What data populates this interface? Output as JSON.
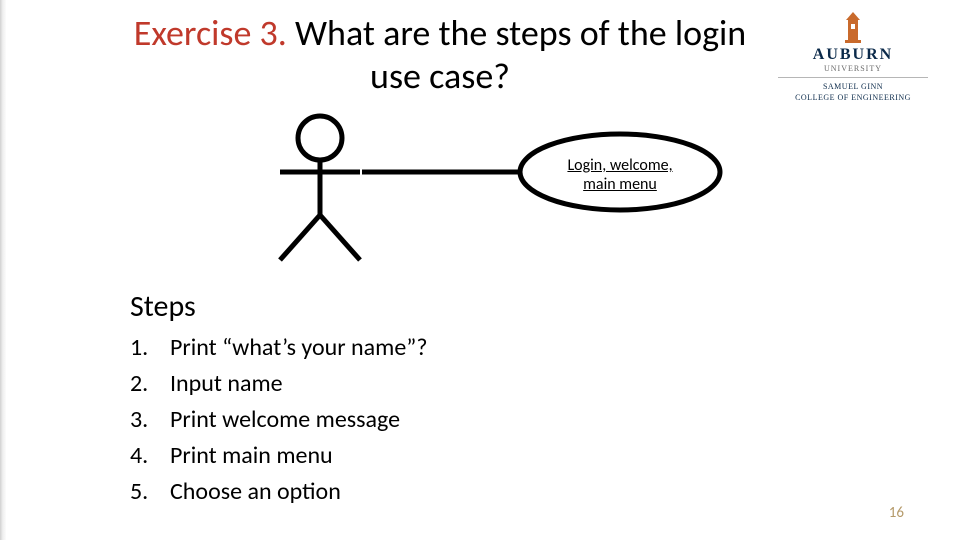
{
  "title": {
    "accent": "Exercise 3.",
    "rest": " What are the steps of the login use case?"
  },
  "logo": {
    "wordmark": "AUBURN",
    "sub1": "UNIVERSITY",
    "sub2": "SAMUEL GINN",
    "sub3": "COLLEGE OF ENGINEERING"
  },
  "diagram": {
    "usecase_line1": "Login, welcome,",
    "usecase_line2": "main menu"
  },
  "steps_heading": "Steps",
  "steps": [
    {
      "n": "1.",
      "text": "Print “what’s your name”?"
    },
    {
      "n": "2.",
      "text": "Input name"
    },
    {
      "n": "3.",
      "text": "Print welcome message"
    },
    {
      "n": "4.",
      "text": "Print main menu"
    },
    {
      "n": "5.",
      "text": "Choose an option"
    }
  ],
  "slide_number": "16"
}
